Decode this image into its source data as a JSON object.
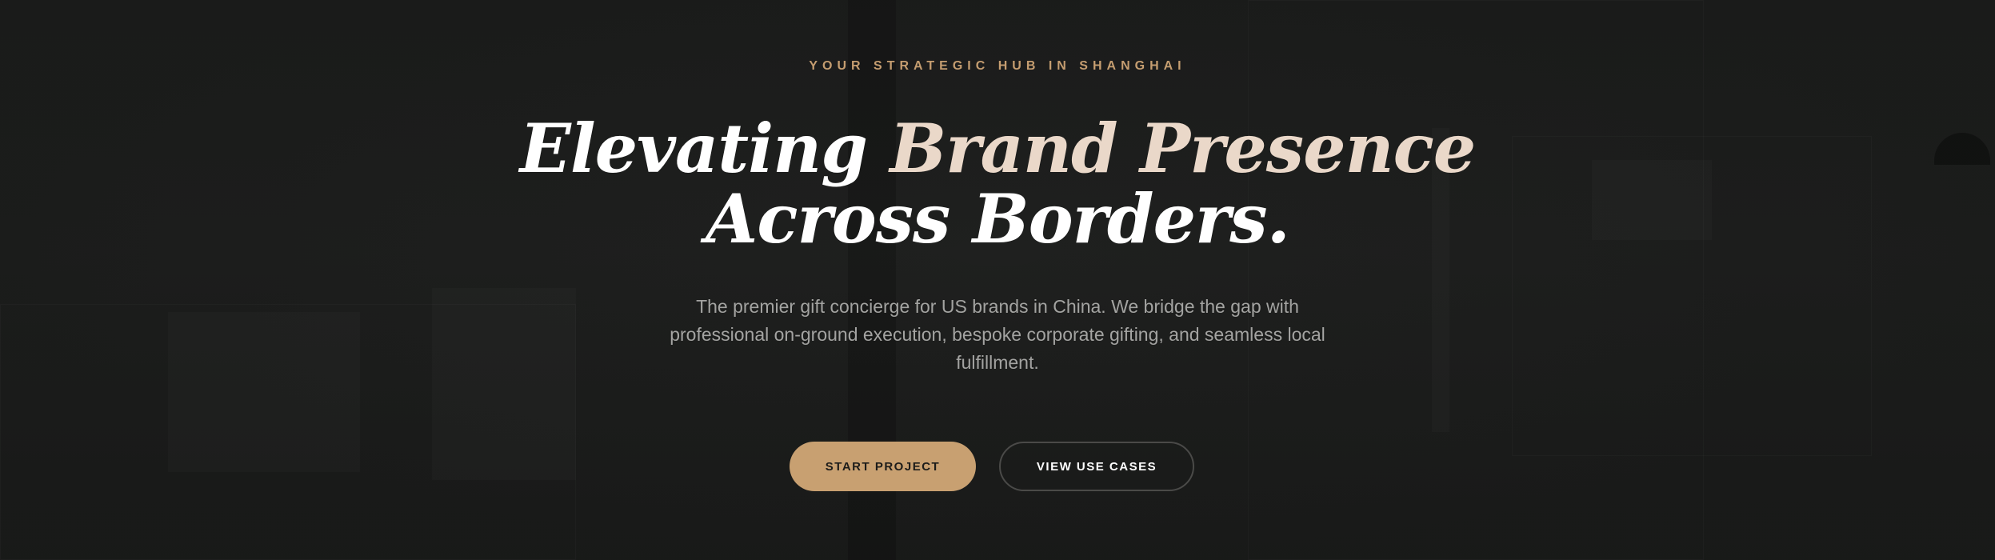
{
  "hero": {
    "eyebrow": "YOUR STRATEGIC HUB IN SHANGHAI",
    "headline": {
      "part1": "Elevating ",
      "accent": "Brand Presence",
      "line2": "Across Borders."
    },
    "subtitle": "The premier gift concierge for US brands in China. We bridge the gap with professional on-ground execution, bespoke corporate gifting, and seamless local fulfillment.",
    "buttons": {
      "primary_label": "START PROJECT",
      "secondary_label": "VIEW USE CASES"
    }
  },
  "colors": {
    "background": "#1d1e1d",
    "accent_gold": "#c59d70",
    "button_gold": "#c8a071",
    "headline_accent": "#ead8c9",
    "subtitle_text": "#a3a3a1"
  }
}
